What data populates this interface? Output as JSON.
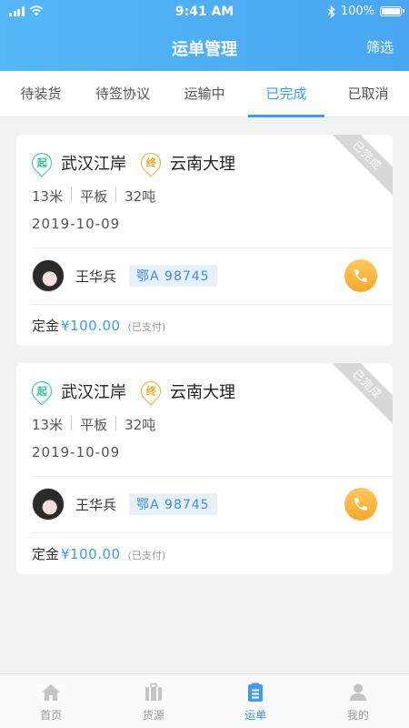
{
  "status_bar": {
    "time": "9:41 AM",
    "battery": "100%",
    "battery_level": 1.0
  },
  "header": {
    "title": "运单管理",
    "filter_label": "筛选"
  },
  "tabs": [
    {
      "label": "待装货",
      "active": false
    },
    {
      "label": "待签协议",
      "active": false
    },
    {
      "label": "运输中",
      "active": false
    },
    {
      "label": "已完成",
      "active": true
    },
    {
      "label": "已取消",
      "active": false
    }
  ],
  "orders": [
    {
      "status": "已完成",
      "start_badge": "起",
      "origin": "武汉江岸",
      "end_badge": "终",
      "destination": "云南大理",
      "specs": [
        "13米",
        "平板",
        "32吨"
      ],
      "date": "2019-10-09",
      "driver_name": "王华兵",
      "plate": "鄂A 98745",
      "deposit_label": "定金",
      "deposit_amount": "¥100.00",
      "deposit_status": "(已支付)"
    },
    {
      "status": "已完成",
      "start_badge": "起",
      "origin": "武汉江岸",
      "end_badge": "终",
      "destination": "云南大理",
      "specs": [
        "13米",
        "平板",
        "32吨"
      ],
      "date": "2019-10-09",
      "driver_name": "王华兵",
      "plate": "鄂A 98745",
      "deposit_label": "定金",
      "deposit_amount": "¥100.00",
      "deposit_status": "(已支付)"
    }
  ],
  "bottom_nav": [
    {
      "label": "首页",
      "icon": "home-icon",
      "active": false
    },
    {
      "label": "货源",
      "icon": "cargo-icon",
      "active": false
    },
    {
      "label": "运单",
      "icon": "waybill-icon",
      "active": true
    },
    {
      "label": "我的",
      "icon": "profile-icon",
      "active": false
    }
  ],
  "colors": {
    "accent": "#3d9bf0",
    "header_start": "#54b7f6",
    "start_pin": "#2ec1a5",
    "end_pin": "#f0a921",
    "call_button": "#f4a92b"
  }
}
